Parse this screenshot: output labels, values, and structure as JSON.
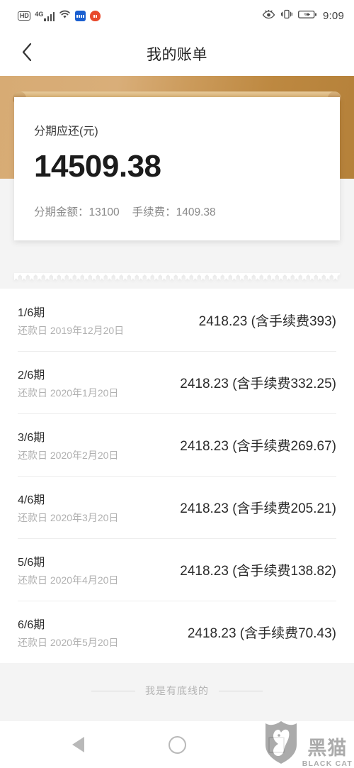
{
  "statusbar": {
    "hd": "HD",
    "network": "4G",
    "time": "9:09",
    "icons": [
      "hd-badge",
      "signal-bars-icon",
      "wifi-icon",
      "app-blue-icon",
      "app-red-icon",
      "eye-comfort-icon",
      "vibrate-icon",
      "battery-charging-icon"
    ]
  },
  "header": {
    "back_icon": "chevron-left-icon",
    "title": "我的账单"
  },
  "summary": {
    "label": "分期应还(元)",
    "amount": "14509.38",
    "principal_label": "分期金额：",
    "principal_value": "13100",
    "fee_label": "手续费：",
    "fee_value": "1409.38",
    "principal_line": "分期金额：13100",
    "fee_line": "手续费：1409.38"
  },
  "installments": [
    {
      "period": "1/6期",
      "duedate": "还款日 2019年12月20日",
      "amount": "2418.23 (含手续费393)"
    },
    {
      "period": "2/6期",
      "duedate": "还款日 2020年1月20日",
      "amount": "2418.23 (含手续费332.25)"
    },
    {
      "period": "3/6期",
      "duedate": "还款日 2020年2月20日",
      "amount": "2418.23 (含手续费269.67)"
    },
    {
      "period": "4/6期",
      "duedate": "还款日 2020年3月20日",
      "amount": "2418.23 (含手续费205.21)"
    },
    {
      "period": "5/6期",
      "duedate": "还款日 2020年4月20日",
      "amount": "2418.23 (含手续费138.82)"
    },
    {
      "period": "6/6期",
      "duedate": "还款日 2020年5月20日",
      "amount": "2418.23 (含手续费70.43)"
    }
  ],
  "footer": {
    "text": "我是有底线的"
  },
  "navbar": {
    "back": "back-triangle-icon",
    "home": "home-circle-icon",
    "recents": "recents-square-icon"
  },
  "watermark": {
    "cn": "黑猫",
    "en": "BLACK CAT"
  },
  "colors": {
    "gold_light": "#d9ae79",
    "gold_dark": "#b5813a",
    "page_bg": "#f4f4f4",
    "card_bg": "#ffffff",
    "text_primary": "#2b2b2b",
    "text_muted": "#b0b0b0"
  }
}
